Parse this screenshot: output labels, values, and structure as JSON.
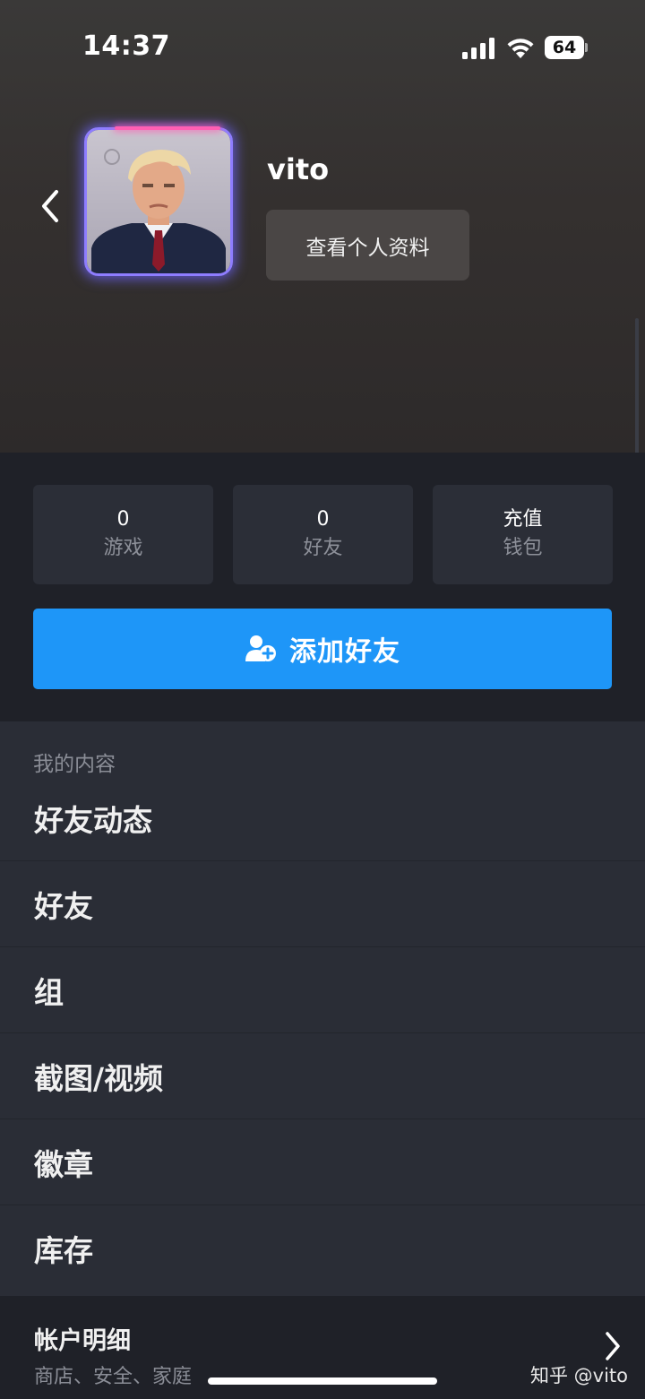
{
  "status_bar": {
    "time": "14:37",
    "battery": "64"
  },
  "profile": {
    "username": "vito",
    "view_profile_label": "查看个人资料"
  },
  "stats": [
    {
      "value": "0",
      "label": "游戏"
    },
    {
      "value": "0",
      "label": "好友"
    },
    {
      "value": "充值",
      "label": "钱包"
    }
  ],
  "add_friend": {
    "label": "添加好友"
  },
  "my_content": {
    "title": "我的内容",
    "items": [
      {
        "label": "好友动态"
      },
      {
        "label": "好友"
      },
      {
        "label": "组"
      },
      {
        "label": "截图/视频"
      },
      {
        "label": "徽章"
      },
      {
        "label": "库存"
      }
    ]
  },
  "account": {
    "title": "帐户明细",
    "subtitle": "商店、安全、家庭"
  },
  "watermark": "知乎 @vito",
  "colors": {
    "accent": "#1e96f8",
    "background": "#2a2d36",
    "panel": "#1f2128",
    "avatar_glow": "#8e7dff"
  }
}
